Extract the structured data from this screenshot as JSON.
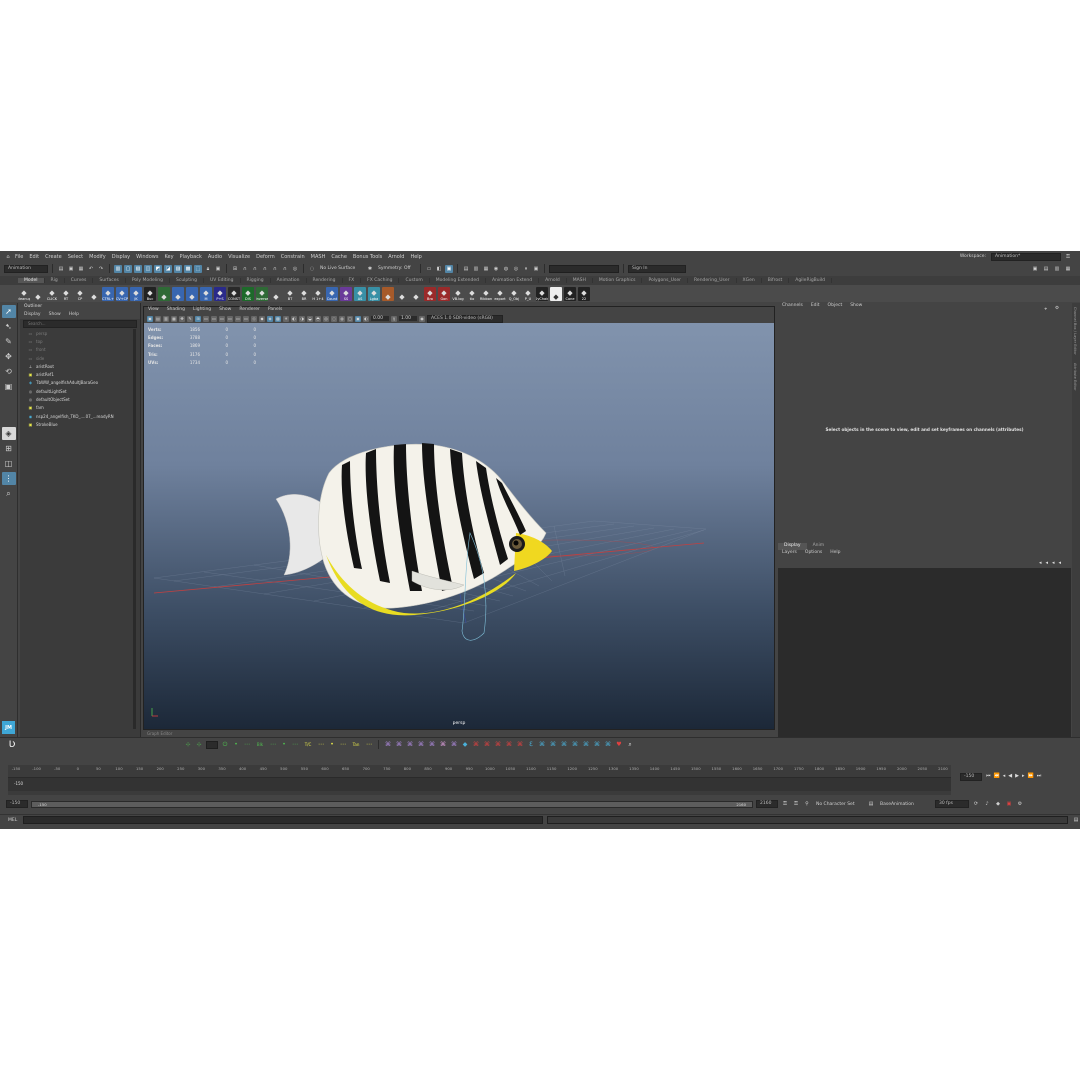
{
  "menubar": {
    "items": [
      "File",
      "Edit",
      "Create",
      "Select",
      "Modify",
      "Display",
      "Windows",
      "Key",
      "Playback",
      "Audio",
      "Visualize",
      "Deform",
      "Constrain",
      "MASH",
      "Cache",
      "Bonus Tools",
      "Arnold",
      "Help"
    ],
    "workspace_label": "Workspace:",
    "workspace_value": "Animation*"
  },
  "statusline": {
    "mode": "Animation",
    "live_surface": "No Live Surface",
    "symmetry": "Symmetry: Off",
    "sign_in": "Sign In"
  },
  "shelf": {
    "tabs": [
      "Model",
      "Rig",
      "Curves",
      "Surfaces",
      "Poly Modeling",
      "Sculpting",
      "UV Editing",
      "Rigging",
      "Animation",
      "Rendering",
      "FX",
      "FX Caching",
      "Custom",
      "Modeling Extended",
      "Animation Extend",
      "Arnold",
      "MASH",
      "Motion Graphics",
      "Polygons_User",
      "Rendering_User",
      "XGen",
      "Bifrost",
      "AgileRigBuild"
    ],
    "active_tab": "Model",
    "buttons": [
      {
        "label": "cleanup",
        "color": "#4b4b4b"
      },
      {
        "label": "",
        "color": "#4b4b4b"
      },
      {
        "label": "CLICK",
        "color": "#4b4b4b"
      },
      {
        "label": "RT",
        "color": "#4b4b4b"
      },
      {
        "label": "CP",
        "color": "#4b4b4b"
      },
      {
        "label": "",
        "color": "#4b4b4b"
      },
      {
        "label": "CTRL+",
        "color": "#3866b0"
      },
      {
        "label": "CV+CP",
        "color": "#3866b0"
      },
      {
        "label": "JK",
        "color": "#3866b0"
      },
      {
        "label": "Buc",
        "color": "#222"
      },
      {
        "label": "",
        "color": "#2f6a36"
      },
      {
        "label": "",
        "color": "#3866b0"
      },
      {
        "label": "",
        "color": "#3866b0"
      },
      {
        "label": "M",
        "color": "#3866b0"
      },
      {
        "label": "P+S",
        "color": "#2a2a8a"
      },
      {
        "label": "CONST",
        "color": "#2a2a2a"
      },
      {
        "label": "DIS",
        "color": "#1d6a2a"
      },
      {
        "label": "Inverse",
        "color": "#2f6a36"
      },
      {
        "label": "",
        "color": "#4b4b4b"
      },
      {
        "label": "BT",
        "color": "#4b4b4b"
      },
      {
        "label": "BR",
        "color": "#4b4b4b"
      },
      {
        "label": "H 1+4",
        "color": "#4b4b4b"
      },
      {
        "label": "Count",
        "color": "#3866b0"
      },
      {
        "label": "SS",
        "color": "#6a3a9a"
      },
      {
        "label": "AS",
        "color": "#3890a6"
      },
      {
        "label": "Lgba",
        "color": "#3890a6"
      },
      {
        "label": "",
        "color": "#a65a2a"
      },
      {
        "label": "",
        "color": "#4b4b4b"
      },
      {
        "label": "",
        "color": "#4b4b4b"
      },
      {
        "label": "Bro",
        "color": "#9a2a2a"
      },
      {
        "label": "Gon",
        "color": "#9a2a2a"
      },
      {
        "label": "VB.log",
        "color": "#4b4b4b"
      },
      {
        "label": "tio",
        "color": "#4b4b4b"
      },
      {
        "label": "Ribbon",
        "color": "#4b4b4b"
      },
      {
        "label": "export",
        "color": "#4b4b4b"
      },
      {
        "label": "Q_Obj",
        "color": "#4b4b4b"
      },
      {
        "label": "P_U",
        "color": "#4b4b4b"
      },
      {
        "label": "DyChain",
        "color": "#222"
      },
      {
        "label": "",
        "color": "#eee"
      },
      {
        "label": "Cone",
        "color": "#222"
      },
      {
        "label": "22",
        "color": "#222"
      }
    ]
  },
  "outliner": {
    "title": "Outliner",
    "menu": [
      "Display",
      "Show",
      "Help"
    ],
    "search_placeholder": "Search...",
    "items": [
      {
        "label": "persp",
        "dim": true,
        "icon": "camera-icon"
      },
      {
        "label": "top",
        "dim": true,
        "icon": "camera-icon"
      },
      {
        "label": "front",
        "dim": true,
        "icon": "camera-icon"
      },
      {
        "label": "side",
        "dim": true,
        "icon": "camera-icon"
      },
      {
        "label": "aristRoot",
        "dim": false,
        "icon": "joint-icon"
      },
      {
        "label": "aristRef1",
        "dim": false,
        "icon": "group-icon"
      },
      {
        "label": "TbWW_angelfishAdultJBaraGeo",
        "dim": false,
        "icon": "mesh-icon"
      },
      {
        "label": "defaultLightSet",
        "dim": false,
        "icon": "set-icon"
      },
      {
        "label": "defaultObjectSet",
        "dim": false,
        "icon": "set-icon"
      },
      {
        "label": "fam",
        "dim": false,
        "icon": "group-icon"
      },
      {
        "label": "nsp24_angelfish_TKO_....07_...readyRN",
        "dim": false,
        "icon": "reference-icon"
      },
      {
        "label": "StrokeBlue",
        "dim": false,
        "icon": "group-icon"
      }
    ]
  },
  "viewport": {
    "menu": [
      "View",
      "Shading",
      "Lighting",
      "Show",
      "Renderer",
      "Panels"
    ],
    "near": "0.00",
    "far": "1.00",
    "colorspace": "ACES 1.0 SDR-video (sRGB)",
    "hud": [
      {
        "k": "Verts:",
        "v": "1856",
        "v2": "0",
        "v3": "0"
      },
      {
        "k": "Edges:",
        "v": "3788",
        "v2": "0",
        "v3": "0"
      },
      {
        "k": "Faces:",
        "v": "1869",
        "v2": "0",
        "v3": "0"
      },
      {
        "k": "Tris:",
        "v": "3176",
        "v2": "0",
        "v3": "0"
      },
      {
        "k": "UVs:",
        "v": "1734",
        "v2": "0",
        "v3": "0"
      }
    ],
    "camera": "persp"
  },
  "channelbox": {
    "menu": [
      "Channels",
      "Edit",
      "Object",
      "Show"
    ],
    "message": "Select objects in the scene to view, edit and set keyframes on channels (attributes)"
  },
  "layers": {
    "tabs": [
      "Display",
      "Anim"
    ],
    "menu": [
      "Layers",
      "Options",
      "Help"
    ]
  },
  "sidetabs": [
    "Channel Box / Layer Editor",
    "Attribute Editor"
  ],
  "graph_editor_label": "Graph Editor",
  "timeline": {
    "ticks": [
      "-150",
      "-100",
      "-50",
      "0",
      "50",
      "100",
      "150",
      "200",
      "250",
      "300",
      "350",
      "400",
      "450",
      "500",
      "550",
      "600",
      "650",
      "700",
      "750",
      "800",
      "850",
      "900",
      "950",
      "1000",
      "1050",
      "1100",
      "1150",
      "1200",
      "1250",
      "1300",
      "1350",
      "1400",
      "1450",
      "1500",
      "1550",
      "1600",
      "1650",
      "1700",
      "1750",
      "1800",
      "1850",
      "1900",
      "1950",
      "2000",
      "2050",
      "2100"
    ],
    "current_frame": "-150",
    "track_start": "-150",
    "clips": [
      {
        "label": "Idle",
        "color": "#4fbf4f",
        "start": 0.02,
        "end": 0.032
      },
      {
        "label": "Swim Forward",
        "color": "#e03a3a",
        "start": 0.053,
        "end": 0.086
      },
      {
        "label": "Swim R Slow",
        "color": "#4fbf4f",
        "start": 0.088,
        "end": 0.116
      },
      {
        "label": "Swim R Fast",
        "color": "#e6e64a",
        "start": 0.118,
        "end": 0.146
      },
      {
        "label": "Swim L Slow",
        "color": "#e8883a",
        "start": 0.148,
        "end": 0.176
      },
      {
        "label": "Swim L Fast",
        "color": "#4ab0d8",
        "start": 0.178,
        "end": 0.206
      },
      {
        "label": "Swim Up",
        "color": "#4fbf4f",
        "start": 0.208,
        "end": 0.236
      },
      {
        "label": "Turn R Slow",
        "color": "#e6e64a",
        "start": 0.238,
        "end": 0.266
      },
      {
        "label": "Turn L Slow",
        "color": "#4ab0d8",
        "start": 0.28,
        "end": 0.31
      },
      {
        "label": "Hide",
        "color": "#e8883a",
        "start": 0.318,
        "end": 0.332
      },
      {
        "label": "Eat Slow",
        "color": "#4fbf4f",
        "start": 0.334,
        "end": 0.356
      },
      {
        "label": "Eat Ground",
        "color": "#4fbf4f",
        "start": 0.358,
        "end": 0.382
      },
      {
        "label": "Jerk",
        "color": "#e6e64a",
        "start": 0.384,
        "end": 0.392
      },
      {
        "label": "Turn L Fast",
        "color": "#4ab0d8",
        "start": 0.394,
        "end": 0.42
      },
      {
        "label": "D.Rot",
        "color": "#b070d8",
        "start": 0.422,
        "end": 0.432
      },
      {
        "label": "Swim Long Idle",
        "color": "#e8883a",
        "start": 0.507,
        "end": 0.566
      },
      {
        "label": "Swim Long Fast",
        "color": "#4fbf4f",
        "start": 0.7,
        "end": 0.766
      },
      {
        "label": "Death1 Side",
        "color": "#f0b0f0",
        "start": 0.818,
        "end": 0.846
      },
      {
        "label": "Death1 Side LP",
        "color": "#f0f0f0",
        "start": 0.846,
        "end": 0.876
      },
      {
        "label": "Death1 Side",
        "color": "#f0b0f0",
        "start": 0.876,
        "end": 0.884
      },
      {
        "label": "Death2 Float",
        "color": "#e03a3a",
        "start": 0.886,
        "end": 0.93
      },
      {
        "label": "Death2 Float Loop",
        "color": "#f0b0f0",
        "start": 0.934,
        "end": 0.978
      },
      {
        "label": "Hit",
        "color": "#4fbf4f",
        "start": 0.98,
        "end": 0.994
      }
    ]
  },
  "range": {
    "start": "-150",
    "inner_start": "-150",
    "inner_end": "2160",
    "end": "2160",
    "character_set": "No Character Set",
    "anim_layer": "BaseAnimation",
    "fps": "30 fps"
  },
  "mel": {
    "label": "MEL"
  }
}
